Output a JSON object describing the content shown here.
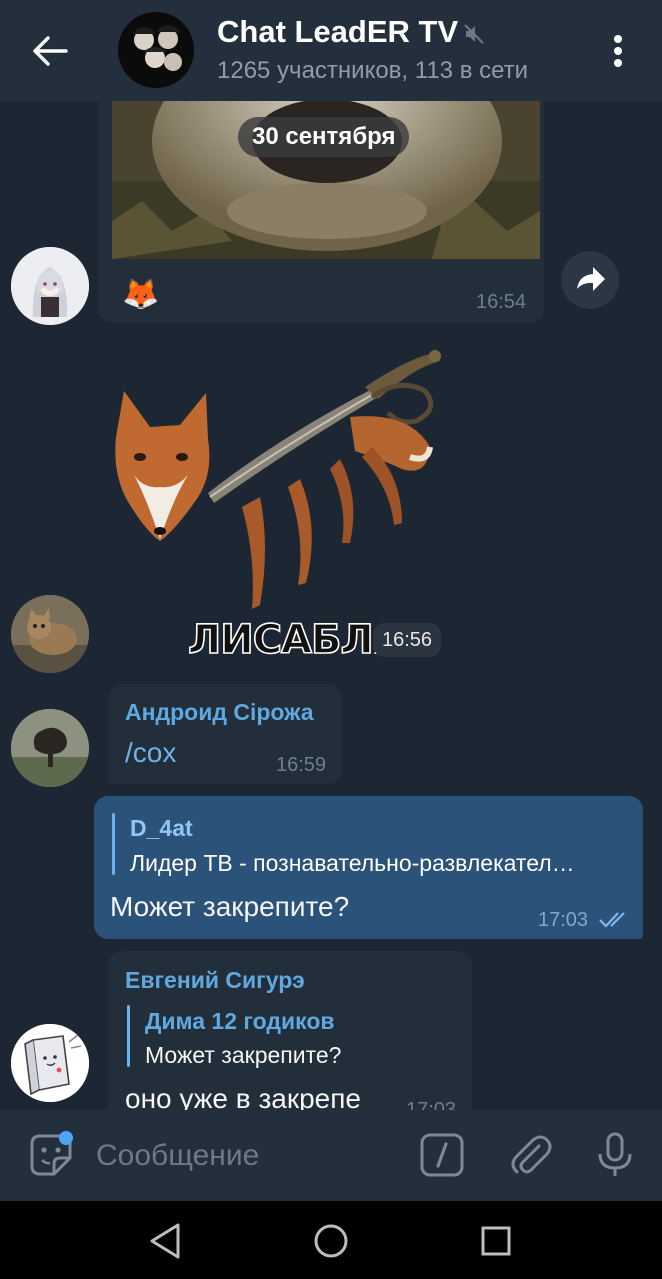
{
  "header": {
    "title": "Chat LeadER TV",
    "subtitle": "1265 участников, 113 в сети"
  },
  "chat": {
    "date_pill": "30 сентября",
    "messages": [
      {
        "type": "media",
        "emoji": "🦊",
        "time": "16:54"
      },
      {
        "type": "sticker",
        "caption": "ЛИСАБЛЯ",
        "time": "16:56"
      },
      {
        "type": "text",
        "sender": "Андроид Сірожа",
        "text": "/cox",
        "time": "16:59"
      },
      {
        "type": "outgoing",
        "quote_name": "D_4at",
        "quote_text": "Лидер ТВ - познавательно-развлекател…",
        "text": "Может закрепите?",
        "time": "17:03"
      },
      {
        "type": "text",
        "sender": "Евгений Сигурэ",
        "quote_name": "Дима 12 годиков",
        "quote_text": "Может закрепите?",
        "text": "оно уже в закрепе",
        "time": "17:03"
      }
    ]
  },
  "input": {
    "placeholder": "Сообщение"
  },
  "colors": {
    "background": "#1d2733",
    "header": "#242f3d",
    "incoming_bubble": "#222e3a",
    "outgoing_bubble": "#2b5278",
    "accent": "#5fa9e0"
  },
  "icons": [
    "arrow-left-icon",
    "muted-icon",
    "more-vert-icon",
    "share-arrow-icon",
    "sticker-emoji-icon",
    "bot-command-icon",
    "paperclip-icon",
    "microphone-icon",
    "nav-back-icon",
    "nav-home-icon",
    "nav-recents-icon"
  ]
}
